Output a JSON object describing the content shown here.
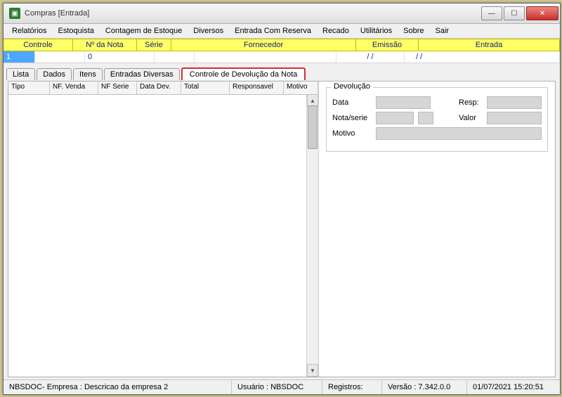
{
  "window": {
    "title": "Compras [Entrada]"
  },
  "menu": [
    "Relatórios",
    "Estoquista",
    "Contagem de Estoque",
    "Diversos",
    "Entrada Com Reserva",
    "Recado",
    "Utilitários",
    "Sobre",
    "Sair"
  ],
  "header_cols": {
    "controle": "Controle",
    "numnota": "Nº da Nota",
    "serie": "Série",
    "fornecedor": "Fornecedor",
    "emissao": "Emissão",
    "entrada": "Entrada"
  },
  "header_vals": {
    "controle": "1",
    "numnota": "0",
    "serie": "",
    "fornecedor": "",
    "emissao": "/  /",
    "entrada": "/  /"
  },
  "tabs": {
    "lista": "Lista",
    "dados": "Dados",
    "itens": "Itens",
    "entradas": "Entradas Diversas",
    "controle": "Controle de Devolução da Nota"
  },
  "grid_cols": {
    "tipo": "Tipo",
    "nfvenda": "NF. Venda",
    "nfserie": "NF Serie",
    "datadev": "Data Dev.",
    "total": "Total",
    "responsavel": "Responsavel",
    "motivo": "Motivo"
  },
  "devolucao": {
    "legend": "Devolução",
    "data_label": "Data",
    "resp_label": "Resp:",
    "nota_label": "Nota/serie",
    "valor_label": "Valor",
    "motivo_label": "Motivo"
  },
  "status": {
    "empresa": "NBSDOC- Empresa : Descricao da empresa 2",
    "usuario": "Usuário : NBSDOC",
    "registros": "Registros:",
    "versao": "Versão : 7.342.0.0",
    "datahora": "01/07/2021 15:20:51"
  }
}
